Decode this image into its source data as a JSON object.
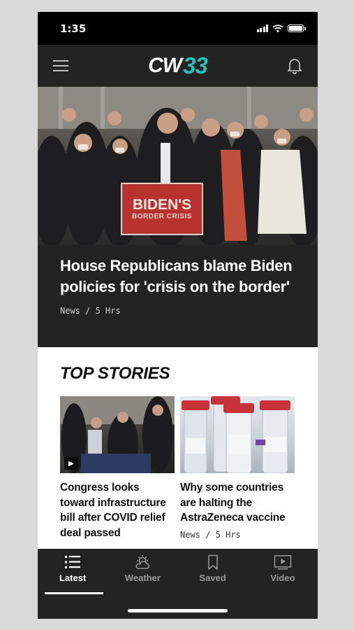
{
  "status_bar": {
    "time": "1:35"
  },
  "header": {
    "logo_left": "CW",
    "logo_right": "33",
    "menu_icon": "hamburger-icon",
    "bell_icon": "bell-icon"
  },
  "hero": {
    "sign_line1": "BIDEN'S",
    "sign_line2": "BORDER CRISIS",
    "title": "House Republicans blame Biden policies for 'crisis on the border'",
    "meta": "News / 5 Hrs"
  },
  "top_stories": {
    "heading": "TOP STORIES",
    "cards": [
      {
        "title": "Congress looks toward infrastructure bill after COVID relief deal passed",
        "meta": "",
        "has_video": true
      },
      {
        "title": "Why some countries are halting the AstraZeneca vaccine",
        "meta": "News / 5 Hrs",
        "has_video": false
      }
    ]
  },
  "tabbar": {
    "tabs": [
      {
        "label": "Latest",
        "icon": "list-icon",
        "active": true
      },
      {
        "label": "Weather",
        "icon": "weather-icon",
        "active": false
      },
      {
        "label": "Saved",
        "icon": "bookmark-icon",
        "active": false
      },
      {
        "label": "Video",
        "icon": "video-icon",
        "active": false
      }
    ]
  },
  "colors": {
    "accent": "#2bbcbc",
    "dark": "#232323",
    "sign_red": "#b8332f"
  }
}
